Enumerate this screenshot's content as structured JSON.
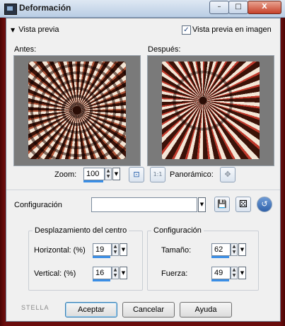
{
  "window": {
    "title": "Deformación",
    "icon": "app-icon",
    "controls": {
      "minimize": "–",
      "maximize": "□",
      "close": "X"
    }
  },
  "preview": {
    "toggle_label": "Vista previa",
    "checkbox_label": "Vista previa en imagen",
    "checkbox_checked": true,
    "checkbox_mark": "✓",
    "before_label": "Antes:",
    "after_label": "Después:"
  },
  "zoom": {
    "label": "Zoom:",
    "value": "100",
    "pan_label": "Panorámico:"
  },
  "config": {
    "label": "Configuración",
    "preset_value": ""
  },
  "center_offset": {
    "title": "Desplazamiento del centro",
    "horizontal_label": "Horizontal: (%)",
    "horizontal_value": "19",
    "vertical_label": "Vertical: (%)",
    "vertical_value": "16"
  },
  "settings": {
    "title": "Configuración",
    "size_label": "Tamaño:",
    "size_value": "62",
    "strength_label": "Fuerza:",
    "strength_value": "49"
  },
  "footer": {
    "brand": "STELLA",
    "ok": "Aceptar",
    "cancel": "Cancelar",
    "help": "Ayuda"
  },
  "icons": {
    "arrow_up": "▲",
    "arrow_down": "▼",
    "zoom_fit": "⊡",
    "zoom_actual": "1:1",
    "pan": "✥",
    "save": "💾",
    "random": "⚄",
    "reset": "↺"
  },
  "colors": {
    "frame": "#6b0d0d",
    "accent_underline": "#3a8ee6",
    "reset_button": "#3a6fb8"
  }
}
